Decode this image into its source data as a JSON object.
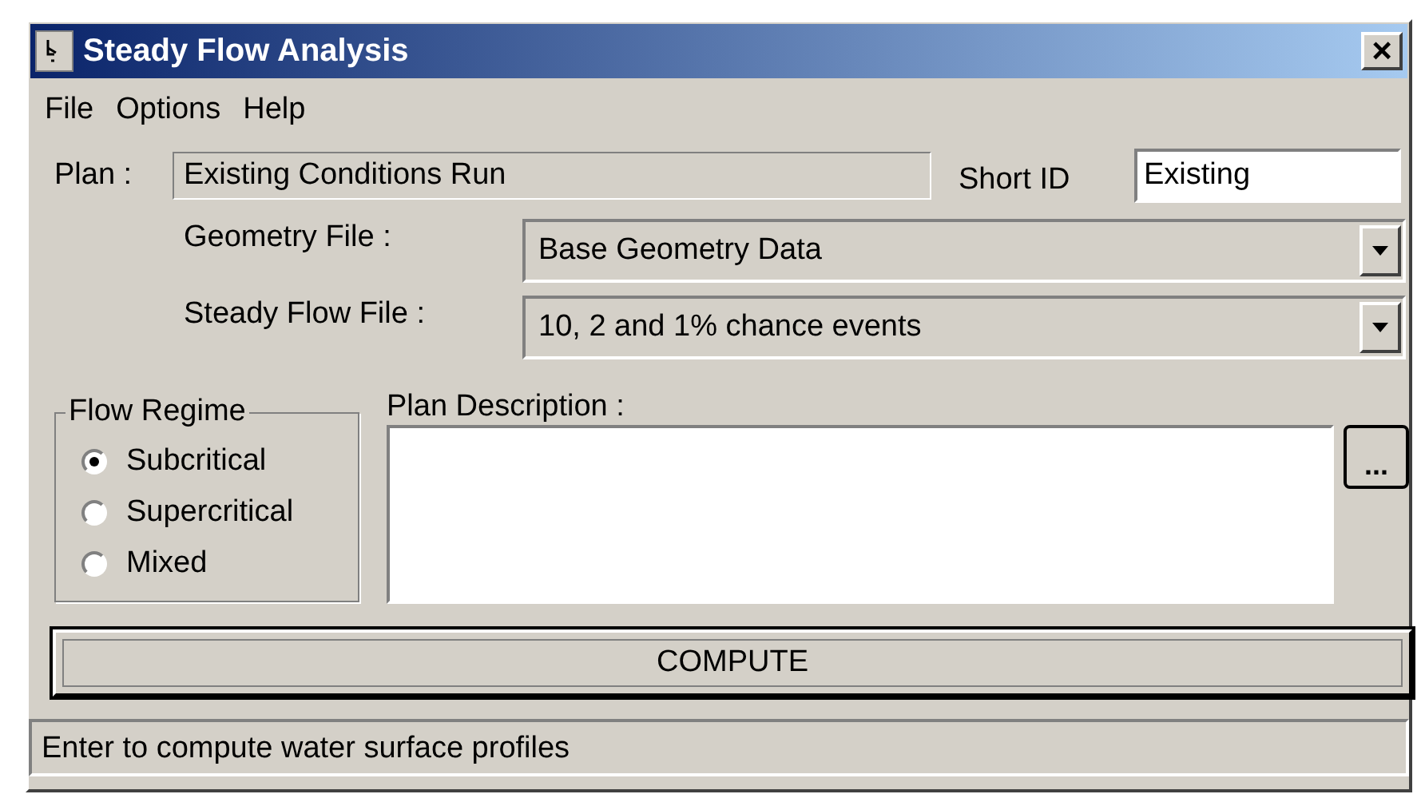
{
  "window": {
    "title": "Steady Flow Analysis",
    "close": "×"
  },
  "menu": [
    {
      "label": "File"
    },
    {
      "label": "Options"
    },
    {
      "label": "Help"
    }
  ],
  "plan": {
    "label": "Plan :",
    "value": "Existing Conditions Run"
  },
  "short_id": {
    "label": "Short ID",
    "value": "Existing"
  },
  "geometry_file": {
    "label": "Geometry File :",
    "value": "Base Geometry Data"
  },
  "steady_flow_file": {
    "label": "Steady Flow File :",
    "value": "10, 2 and 1% chance events"
  },
  "flow_regime": {
    "title": "Flow Regime",
    "options": [
      {
        "label": "Subcritical",
        "selected": true
      },
      {
        "label": "Supercritical",
        "selected": false
      },
      {
        "label": "Mixed",
        "selected": false
      }
    ]
  },
  "plan_description": {
    "label": "Plan Description :",
    "browse": "..."
  },
  "compute_button": {
    "label": "COMPUTE",
    "focused": true
  },
  "status_bar": {
    "text": "Enter to compute water surface profiles"
  }
}
